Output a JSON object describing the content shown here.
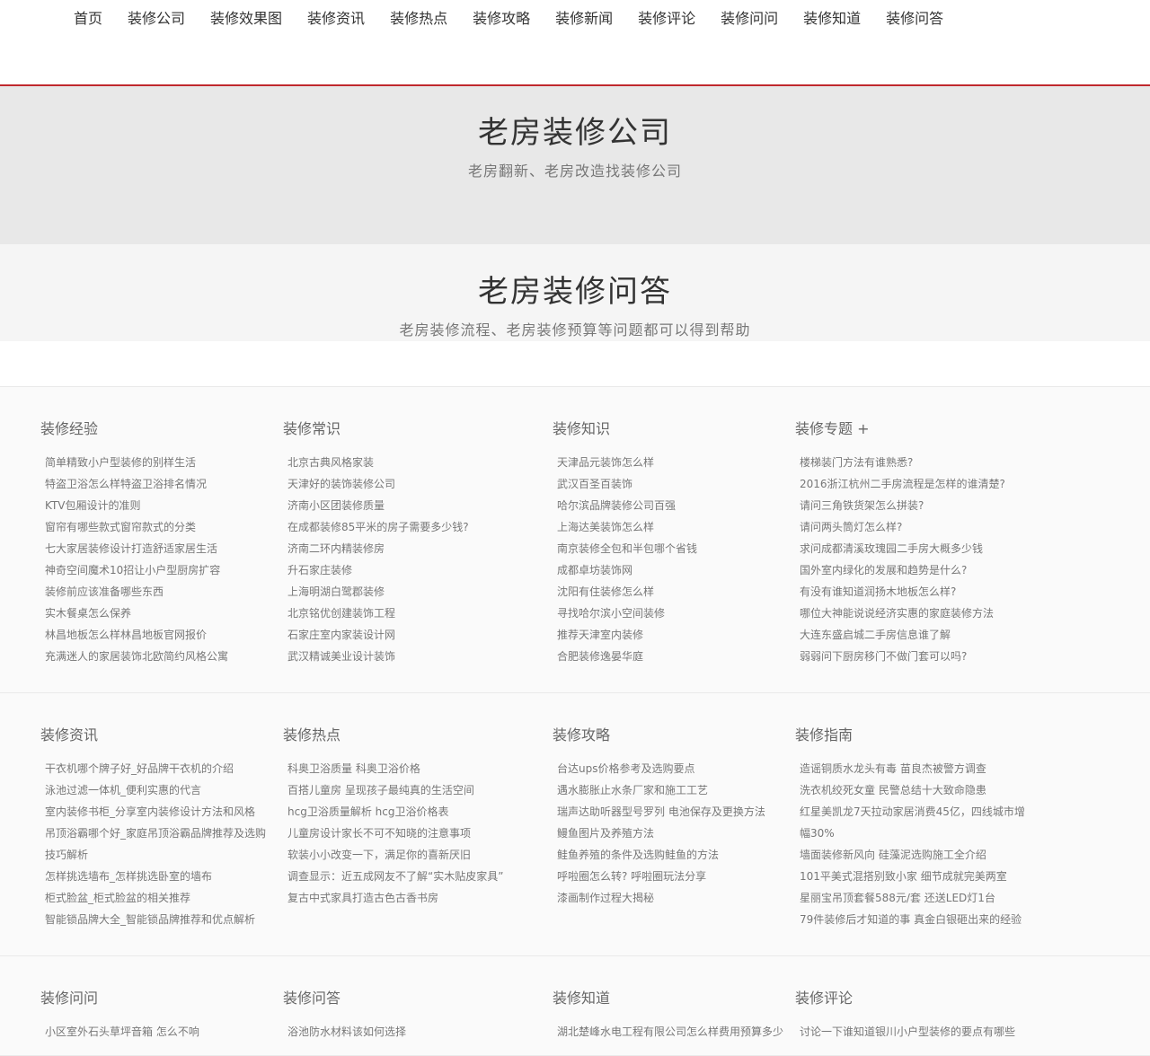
{
  "nav": [
    "首页",
    "装修公司",
    "装修效果图",
    "装修资讯",
    "装修热点",
    "装修攻略",
    "装修新闻",
    "装修评论",
    "装修问问",
    "装修知道",
    "装修问答"
  ],
  "hero": {
    "title": "老房装修公司",
    "subtitle": "老房翻新、老房改造找装修公司"
  },
  "qa": {
    "title": "老房装修问答",
    "subtitle": "老房装修流程、老房装修预算等问题都可以得到帮助"
  },
  "sections": [
    [
      {
        "title": "装修经验",
        "items": [
          "简单精致小户型装修的别样生活",
          "特盗卫浴怎么样特盗卫浴排名情况",
          "KTV包厢设计的准则",
          "窗帘有哪些款式窗帘款式的分类",
          "七大家居装修设计打造舒适家居生活",
          "神奇空间魔术10招让小户型厨房扩容",
          "装修前应该准备哪些东西",
          "实木餐桌怎么保养",
          "林昌地板怎么样林昌地板官网报价",
          "充满迷人的家居装饰北欧简约风格公寓"
        ]
      },
      {
        "title": "装修常识",
        "items": [
          "北京古典风格家装",
          "天津好的装饰装修公司",
          "济南小区团装修质量",
          "在成都装修85平米的房子需要多少钱?",
          "济南二环内精装修房",
          "升石家庄装修",
          "上海明湖白鹭郡装修",
          "北京铭优创建装饰工程",
          "石家庄室内家装设计网",
          "武汉精诚美业设计装饰"
        ]
      },
      {
        "title": "装修知识",
        "items": [
          "天津品元装饰怎么样",
          "武汉百圣百装饰",
          "哈尔滨品牌装修公司百强",
          "上海达美装饰怎么样",
          "南京装修全包和半包哪个省钱",
          "成都卓坊装饰网",
          "沈阳有住装修怎么样",
          "寻找哈尔滨小空间装修",
          "推荐天津室内装修",
          "合肥装修逸晏华庭"
        ]
      },
      {
        "title": "装修专题 +",
        "items": [
          "楼梯装门方法有谁熟悉?",
          "2016浙江杭州二手房流程是怎样的谁清楚?",
          "请问三角铁货架怎么拼装?",
          "请问两头筒灯怎么样?",
          "求问成都清溪玫瑰园二手房大概多少钱",
          "国外室内绿化的发展和趋势是什么?",
          "有没有谁知道润扬木地板怎么样?",
          "哪位大神能说说经济实惠的家庭装修方法",
          "大连东盛启城二手房信息谁了解",
          "弱弱问下厨房移门不做门套可以吗?"
        ]
      }
    ],
    [
      {
        "title": "装修资讯",
        "items": [
          "干衣机哪个牌子好_好品牌干衣机的介绍",
          "泳池过滤一体机_便利实惠的代言",
          "室内装修书柜_分享室内装修设计方法和风格",
          "吊顶浴霸哪个好_家庭吊顶浴霸品牌推荐及选购技巧解析",
          "怎样挑选墙布_怎样挑选卧室的墙布",
          "柜式脸盆_柜式脸盆的相关推荐",
          "智能锁品牌大全_智能锁品牌推荐和优点解析"
        ]
      },
      {
        "title": "装修热点",
        "items": [
          "科奥卫浴质量 科奥卫浴价格",
          "百搭儿童房 呈现孩子最纯真的生活空间",
          "hcg卫浴质量解析 hcg卫浴价格表",
          "儿童房设计家长不可不知晓的注意事项",
          "软装小小改变一下，满足你的喜新厌旧",
          "调查显示：近五成网友不了解“实木贴皮家具”",
          "复古中式家具打造古色古香书房"
        ]
      },
      {
        "title": "装修攻略",
        "items": [
          "台达ups价格参考及选购要点",
          "遇水膨胀止水条厂家和施工工艺",
          "瑞声达助听器型号罗列 电池保存及更换方法",
          "鳗鱼图片及养殖方法",
          "鲑鱼养殖的条件及选购鲑鱼的方法",
          "呼啦圈怎么转? 呼啦圈玩法分享",
          "漆画制作过程大揭秘"
        ]
      },
      {
        "title": "装修指南",
        "items": [
          "造谣铜质水龙头有毒 苗良杰被警方调查",
          "洗衣机绞死女童 民警总结十大致命隐患",
          "红星美凯龙7天拉动家居消费45亿，四线城市增幅30%",
          "墙面装修新风向 硅藻泥选购施工全介绍",
          "101平美式混搭别致小家 细节成就完美两室",
          "星丽宝吊顶套餐588元/套 还送LED灯1台",
          "79件装修后才知道的事 真金白银砸出来的经验"
        ]
      }
    ],
    [
      {
        "title": "装修问问",
        "items": [
          "小区室外石头草坪音箱 怎么不响"
        ]
      },
      {
        "title": "装修问答",
        "items": [
          "浴池防水材料该如何选择"
        ]
      },
      {
        "title": "装修知道",
        "items": [
          "湖北楚峰水电工程有限公司怎么样费用预算多少"
        ]
      },
      {
        "title": "装修评论",
        "items": [
          "讨论一下谁知道银川小户型装修的要点有哪些"
        ]
      }
    ]
  ]
}
